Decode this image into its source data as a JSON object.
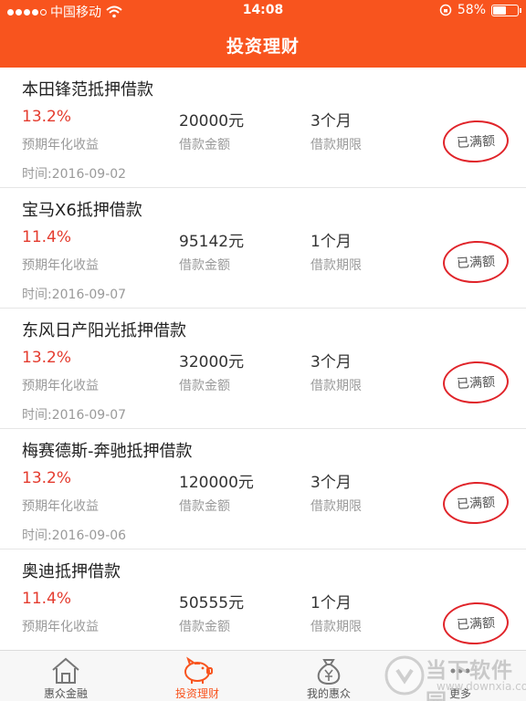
{
  "status_bar": {
    "carrier": "中国移动",
    "time": "14:08",
    "battery_percent": "58%",
    "battery_level": 0.58
  },
  "header": {
    "title": "投资理财"
  },
  "labels": {
    "rate_label": "预期年化收益",
    "amount_label": "借款金额",
    "term_label": "借款期限"
  },
  "loans": [
    {
      "title": "本田锋范抵押借款",
      "rate": "13.2%",
      "amount": "20000元",
      "term": "3个月",
      "date": "时间:2016-09-02",
      "status": "已满额"
    },
    {
      "title": "宝马X6抵押借款",
      "rate": "11.4%",
      "amount": "95142元",
      "term": "1个月",
      "date": "时间:2016-09-07",
      "status": "已满额"
    },
    {
      "title": "东风日产阳光抵押借款",
      "rate": "13.2%",
      "amount": "32000元",
      "term": "3个月",
      "date": "时间:2016-09-07",
      "status": "已满额"
    },
    {
      "title": "梅赛德斯-奔驰抵押借款",
      "rate": "13.2%",
      "amount": "120000元",
      "term": "3个月",
      "date": "时间:2016-09-06",
      "status": "已满额"
    },
    {
      "title": "奥迪抵押借款",
      "rate": "11.4%",
      "amount": "50555元",
      "term": "1个月",
      "date": "",
      "status": "已满额"
    }
  ],
  "tabs": [
    {
      "label": "惠众金融",
      "icon": "home-icon"
    },
    {
      "label": "投资理财",
      "icon": "piggy-bank-icon",
      "active": true
    },
    {
      "label": "我的惠众",
      "icon": "money-bag-icon"
    },
    {
      "label": "更多",
      "icon": "more-icon"
    }
  ],
  "watermark": {
    "text": "当下软件园",
    "url": "www.downxia.com"
  },
  "colors": {
    "accent": "#f8541e",
    "rate": "#e43b2e",
    "stamp": "#e0242a"
  }
}
